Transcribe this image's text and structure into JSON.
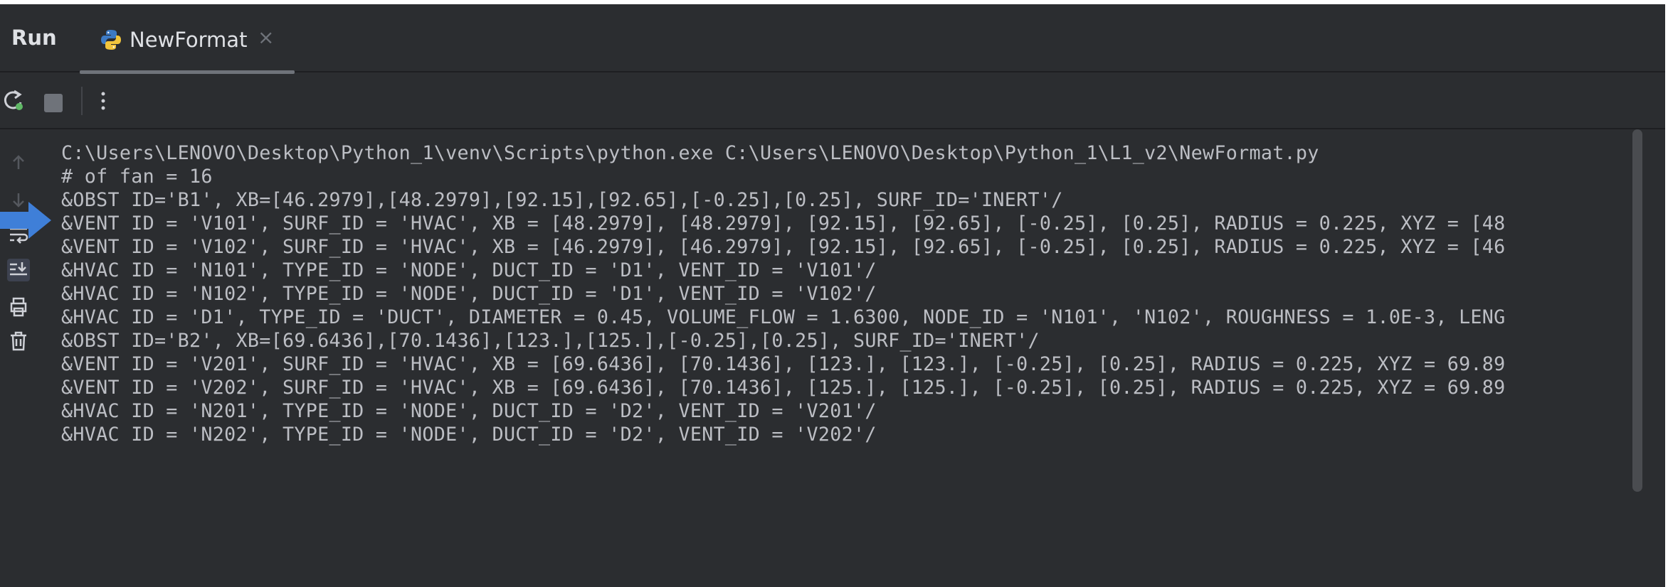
{
  "tabbar": {
    "run_label": "Run",
    "tab": {
      "label": "NewFormat",
      "icon": "python-icon",
      "close_glyph": "×"
    }
  },
  "toolbar": {
    "icons": [
      "rerun-icon",
      "stop-icon",
      "more-icon"
    ]
  },
  "gutter": {
    "icons": [
      "scroll-up-icon",
      "scroll-down-icon",
      "soft-wrap-icon",
      "scroll-to-end-icon",
      "print-icon",
      "clear-all-icon"
    ]
  },
  "console": {
    "lines": [
      "C:\\Users\\LENOVO\\Desktop\\Python_1\\venv\\Scripts\\python.exe C:\\Users\\LENOVO\\Desktop\\Python_1\\L1_v2\\NewFormat.py",
      "# of fan = 16",
      "&OBST ID='B1', XB=[46.2979],[48.2979],[92.15],[92.65],[-0.25],[0.25], SURF_ID='INERT'/",
      "&VENT ID = 'V101', SURF_ID = 'HVAC', XB = [48.2979], [48.2979], [92.15], [92.65], [-0.25], [0.25], RADIUS = 0.225, XYZ = [48",
      "&VENT ID = 'V102', SURF_ID = 'HVAC', XB = [46.2979], [46.2979], [92.15], [92.65], [-0.25], [0.25], RADIUS = 0.225, XYZ = [46",
      "&HVAC ID = 'N101', TYPE_ID = 'NODE', DUCT_ID = 'D1', VENT_ID = 'V101'/",
      "&HVAC ID = 'N102', TYPE_ID = 'NODE', DUCT_ID = 'D1', VENT_ID = 'V102'/",
      "&HVAC ID = 'D1', TYPE_ID = 'DUCT', DIAMETER = 0.45, VOLUME_FLOW = 1.6300, NODE_ID = 'N101', 'N102', ROUGHNESS = 1.0E-3, LENG",
      "&OBST ID='B2', XB=[69.6436],[70.1436],[123.],[125.],[-0.25],[0.25], SURF_ID='INERT'/",
      "&VENT ID = 'V201', SURF_ID = 'HVAC', XB = [69.6436], [70.1436], [123.], [123.], [-0.25], [0.25], RADIUS = 0.225, XYZ = 69.89",
      "&VENT ID = 'V202', SURF_ID = 'HVAC', XB = [69.6436], [70.1436], [125.], [125.], [-0.25], [0.25], RADIUS = 0.225, XYZ = 69.89",
      "&HVAC ID = 'N201', TYPE_ID = 'NODE', DUCT_ID = 'D2', VENT_ID = 'V201'/",
      "&HVAC ID = 'N202', TYPE_ID = 'NODE', DUCT_ID = 'D2', VENT_ID = 'V202'/"
    ]
  },
  "colors": {
    "background": "#2b2d30",
    "text": "#bcbec4",
    "marker_arrow": "#3f7fd8"
  }
}
